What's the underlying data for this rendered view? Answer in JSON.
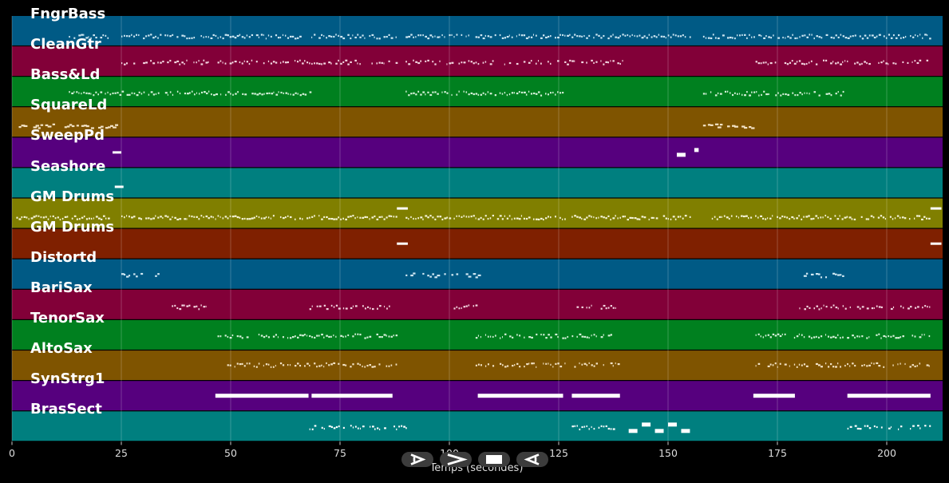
{
  "timeline": {
    "x_label": "Temps (secondes)",
    "ticks": [
      "0",
      "25",
      "50",
      "75",
      "100",
      "125",
      "150",
      "175",
      "200"
    ]
  },
  "tracks": [
    {
      "name": "FngrBass",
      "color": "#005a85",
      "note": "#cfe7f2"
    },
    {
      "name": "CleanGtr",
      "color": "#820038",
      "note": "#f3d6e0"
    },
    {
      "name": "Bass&Ld",
      "color": "#00801f",
      "note": "#d5f0d9"
    },
    {
      "name": "SquareLd",
      "color": "#7f5400",
      "note": "#f3e3c6"
    },
    {
      "name": "SweepPd",
      "color": "#56007e",
      "note": "#ffffff"
    },
    {
      "name": "Seashore",
      "color": "#007f7f",
      "note": "#ffffff"
    },
    {
      "name": "GM Drums",
      "color": "#807f00",
      "note": "#f5f4d8"
    },
    {
      "name": "GM Drums",
      "color": "#7f2000",
      "note": "#ffffff"
    },
    {
      "name": "Distortd",
      "color": "#005a85",
      "note": "#cfe7f2"
    },
    {
      "name": "BariSax",
      "color": "#820038",
      "note": "#f3d6e0"
    },
    {
      "name": "TenorSax",
      "color": "#00801f",
      "note": "#d5f0d9"
    },
    {
      "name": "AltoSax",
      "color": "#7f5400",
      "note": "#f3e3c6"
    },
    {
      "name": "SynStrg1",
      "color": "#56007e",
      "note": "#ffffff"
    },
    {
      "name": "BrasSect",
      "color": "#007f7f",
      "note": "#ffffff"
    }
  ],
  "controls": [
    {
      "name": "play-icon"
    },
    {
      "name": "fast-forward-icon"
    },
    {
      "name": "stop-icon"
    },
    {
      "name": "rewind-icon"
    }
  ]
}
